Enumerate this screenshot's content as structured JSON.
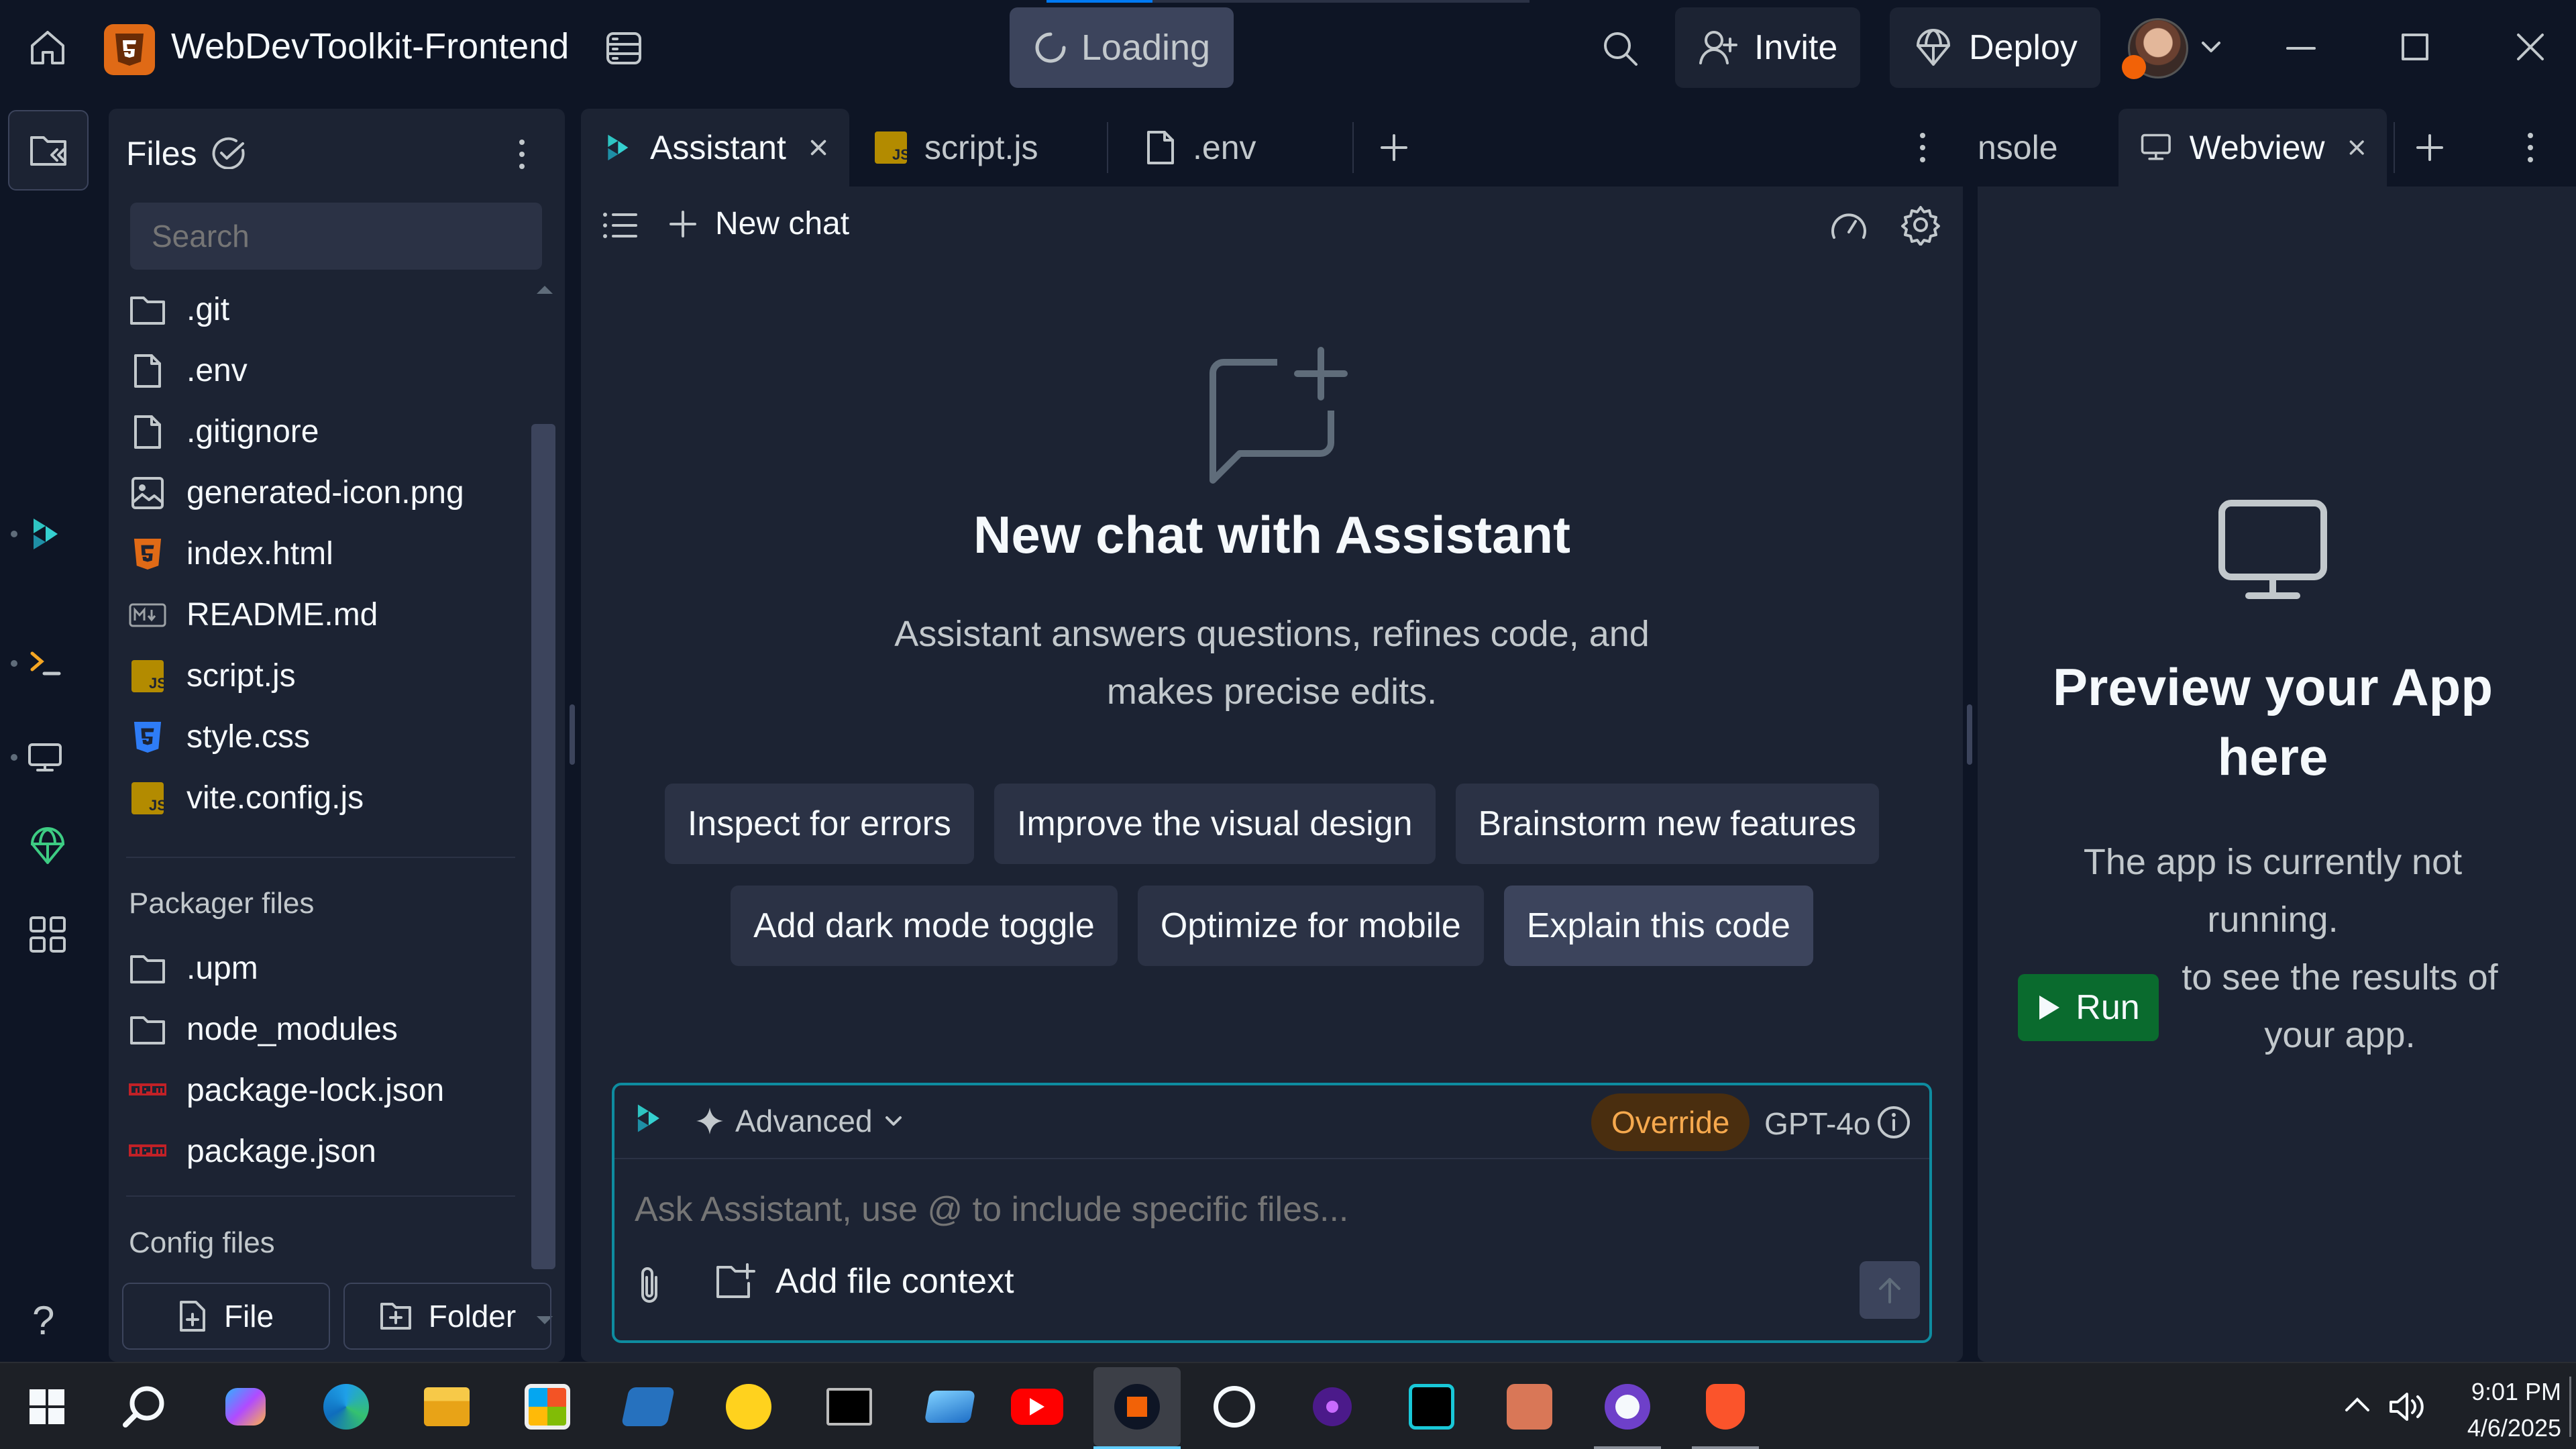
{
  "topbar": {
    "project_name": "WebDevToolkit-Frontend",
    "status": "Loading",
    "invite": "Invite",
    "deploy": "Deploy"
  },
  "files": {
    "title": "Files",
    "search_placeholder": "Search",
    "items": [
      ".git",
      ".env",
      ".gitignore",
      "generated-icon.png",
      "index.html",
      "README.md",
      "script.js",
      "style.css",
      "vite.config.js"
    ],
    "packager_title": "Packager files",
    "packager_items": [
      ".upm",
      "node_modules",
      "package-lock.json",
      "package.json"
    ],
    "config_title": "Config files",
    "new_file": "File",
    "new_folder": "Folder"
  },
  "editor": {
    "tabs": [
      "Assistant",
      "script.js",
      ".env"
    ],
    "new_chat": "New chat",
    "heading": "New chat with Assistant",
    "subtitle": "Assistant answers questions, refines code, and makes precise edits.",
    "suggestions_row1": [
      "Inspect for errors",
      "Improve the visual design",
      "Brainstorm new features"
    ],
    "suggestions_row2": [
      "Add dark mode toggle",
      "Optimize for mobile",
      "Explain this code"
    ],
    "mode": "Advanced",
    "override": "Override",
    "model": "GPT-4o",
    "input_placeholder": "Ask Assistant, use @ to include specific files...",
    "add_context": "Add file context"
  },
  "preview": {
    "tabs": [
      "nsole",
      "Webview"
    ],
    "heading": "Preview your App here",
    "text1": "The app is currently not running.",
    "run": "Run",
    "text2": "to see the results of your app."
  },
  "taskbar": {
    "time": "9:01 PM",
    "date": "4/6/2025",
    "icons": [
      "windows-icon",
      "search-icon",
      "copilot-icon",
      "edge-icon",
      "file-explorer-icon",
      "store-icon",
      "powershell-icon",
      "huggingface-icon",
      "terminal-icon",
      "remote-desktop-icon",
      "youtube-icon",
      "replit-icon",
      "chatgpt-icon",
      "perplexity-icon",
      "cursor-icon",
      "claude-icon",
      "github-icon",
      "brave-icon"
    ]
  },
  "colors": {
    "bg": "#0e1525",
    "surface": "#1c2333",
    "chip": "#2b3245",
    "accent": "#0079f2",
    "run_green": "#0a6b2e",
    "override_bg": "#4a2e0f",
    "override_text": "#f6a94e"
  }
}
